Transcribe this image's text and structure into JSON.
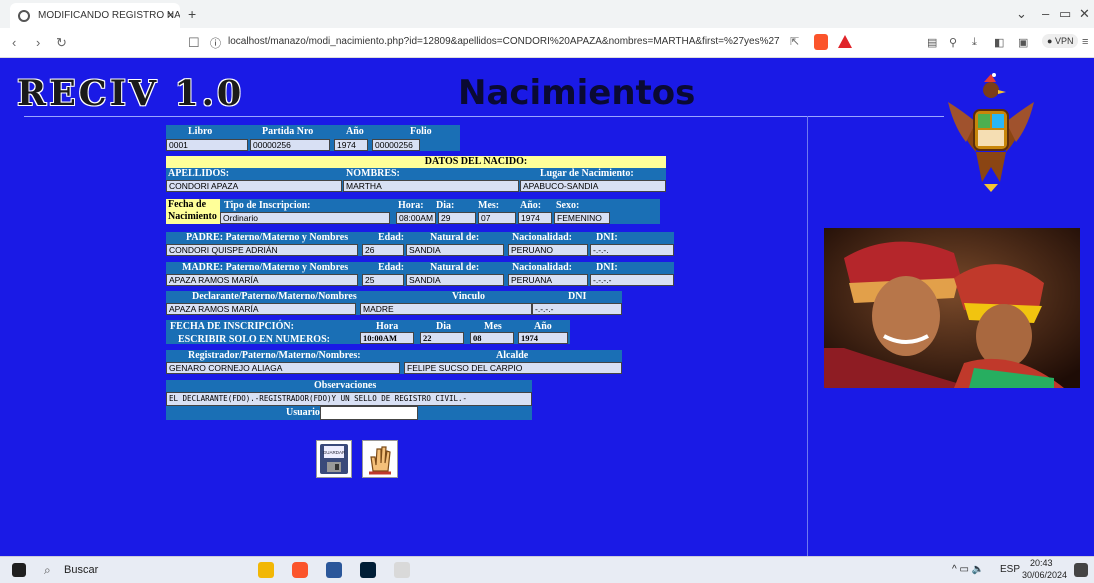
{
  "browser": {
    "tab_title": "MODIFICANDO REGISTRO NACI",
    "url": "localhost/manazo/modi_nacimiento.php?id=12809&apellidos=CONDORI%20APAZA&nombres=MARTHA&first=%27yes%27",
    "vpn_label": "VPN"
  },
  "page": {
    "logo": "RECIV 1.0",
    "title": "Nacimientos",
    "libro_hdr": "Libro",
    "partida_hdr": "Partida Nro",
    "anio_hdr": "Año",
    "folio_hdr": "Folio",
    "libro": "0001",
    "partida": "00000256",
    "anio": "1974",
    "folio": "00000256",
    "datos_hdr": "DATOS DEL NACIDO:",
    "apellidos_hdr": "APELLIDOS:",
    "nombres_hdr": "NOMBRES:",
    "lugar_hdr": "Lugar de Nacimiento:",
    "apellidos": "CONDORI APAZA",
    "nombres": "MARTHA",
    "lugar": "APABUCO-SANDIA",
    "fecha_de": "Fecha de",
    "nacimiento": "Nacimiento",
    "tipo_hdr": "Tipo de Inscripcion:",
    "hora_hdr": "Hora:",
    "dia_hdr": "Dia:",
    "mes_hdr": "Mes:",
    "anio2_hdr": "Año:",
    "sexo_hdr": "Sexo:",
    "tipo": "Ordinario",
    "hora": "08:00AM",
    "dia": "29",
    "mes": "07",
    "anio_nac": "1974",
    "sexo": "FEMENINO",
    "padre_hdr": "PADRE: Paterno/Materno y Nombres",
    "edad_hdr": "Edad:",
    "natural_hdr": "Natural de:",
    "nacionalidad_hdr": "Nacionalidad:",
    "dni_hdr": "DNI:",
    "padre": "CONDORI QUISPE ADRIÁN",
    "padre_edad": "26",
    "padre_natural": "SANDIA",
    "padre_nac": "PERUANO",
    "padre_dni": "-.-.-.",
    "madre_hdr": "MADRE: Paterno/Materno y Nombres",
    "madre": "APAZA RAMOS MARÍA",
    "madre_edad": "25",
    "madre_natural": "SANDIA",
    "madre_nac": "PERUANA",
    "madre_dni": "-.-.-.-",
    "declarante_hdr": "Declarante/Paterno/Materno/Nombres",
    "vinculo_hdr": "Vinculo",
    "dni3_hdr": "DNI",
    "declarante": "APAZA RAMOS MARÍA",
    "vinculo": "MADRE",
    "declarante_dni": "-.-.-.-",
    "fecha_insc_hdr": "FECHA DE INSCRIPCIÓN:",
    "escribir": "ESCRIBIR SOLO EN NUMEROS:",
    "hora3_hdr": "Hora",
    "dia3_hdr": "Dia",
    "mes3_hdr": "Mes",
    "anio3_hdr": "Año",
    "insc_hora": "10:00AM",
    "insc_dia": "22",
    "insc_mes": "08",
    "insc_anio": "1974",
    "registrador_hdr": "Registrador/Paterno/Materno/Nombres:",
    "alcalde_hdr": "Alcalde",
    "registrador": "GENARO CORNEJO ALIAGA",
    "alcalde": "FELIPE SUCSO DEL CARPIO",
    "obs_hdr": "Observaciones",
    "obs": "EL DECLARANTE(FDO).-REGISTRADOR(FDO)Y UN SELLO DE REGISTRO CIVIL.-",
    "usuario_lbl": "Usuario:",
    "usuario": "",
    "guardar": "GUARDAR"
  },
  "taskbar": {
    "search": "Buscar",
    "lang": "ESP",
    "time": "20:43",
    "date": "30/06/2024"
  },
  "colors": {
    "page_bg": "#1a1ae6",
    "header_bg": "#1a6fb5",
    "field_bg": "#d8e0f4",
    "highlight": "#ffff99"
  }
}
